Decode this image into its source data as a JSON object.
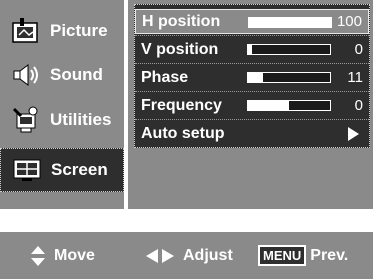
{
  "categories": [
    {
      "label": "Picture",
      "icon": "picture-icon",
      "selected": false
    },
    {
      "label": "Sound",
      "icon": "speaker-icon",
      "selected": false
    },
    {
      "label": "Utilities",
      "icon": "tools-icon",
      "selected": false
    },
    {
      "label": "Screen",
      "icon": "screen-icon",
      "selected": true
    }
  ],
  "settings": [
    {
      "label": "H position",
      "value": "100",
      "level": 1.0,
      "highlighted": true
    },
    {
      "label": "V position",
      "value": "0",
      "level": 0.05,
      "highlighted": false
    },
    {
      "label": "Phase",
      "value": "11",
      "level": 0.18,
      "highlighted": false
    },
    {
      "label": "Frequency",
      "value": "0",
      "level": 0.5,
      "highlighted": false
    },
    {
      "label": "Auto setup",
      "highlighted": false
    }
  ],
  "help": {
    "move": "Move",
    "adjust": "Adjust",
    "menu_key": "MENU",
    "prev": "Prev."
  },
  "colors": {
    "panel_gray": "#8a8a8a",
    "dark": "#2e2e2e",
    "text": "#ffffff"
  }
}
